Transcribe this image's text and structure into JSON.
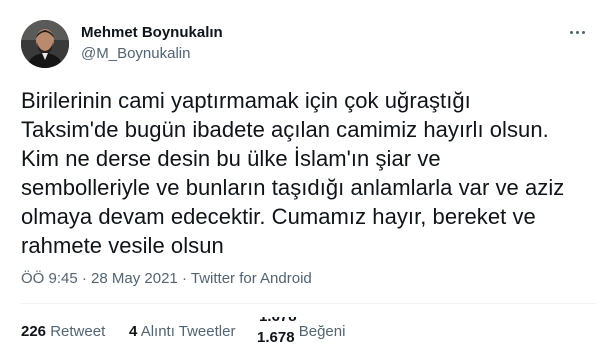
{
  "author": {
    "name": "Mehmet Boynukalın",
    "handle": "@M_Boynukalin"
  },
  "tweet": {
    "lines": [
      "Birilerinin cami yaptırmamak için çok uğraştığı",
      "Taksim'de bugün ibadete açılan camimiz hayırlı olsun.",
      "Kim ne derse desin bu ülke İslam'ın şiar ve",
      "sembolleriyle ve bunların taşıdığı anlamlarla var ve aziz",
      "olmaya devam edecektir. Cumamız hayır, bereket ve",
      "rahmete vesile olsun"
    ]
  },
  "meta": {
    "time": "ÖÖ 9:45",
    "separator1": "·",
    "date": "28 May 2021",
    "separator2": "·",
    "source": "Twitter for Android"
  },
  "stats": {
    "retweets": {
      "count": "226",
      "label": "Retweet"
    },
    "quotes": {
      "count": "4",
      "label": "Alıntı Tweetler"
    },
    "likes": {
      "count": "1.678",
      "ghost": "1.678",
      "label": "Beğeni"
    }
  },
  "icons": {
    "more": "more-horizontal-icon"
  },
  "colors": {
    "text": "#0f1419",
    "secondary": "#536471",
    "divider": "#eff3f4"
  }
}
